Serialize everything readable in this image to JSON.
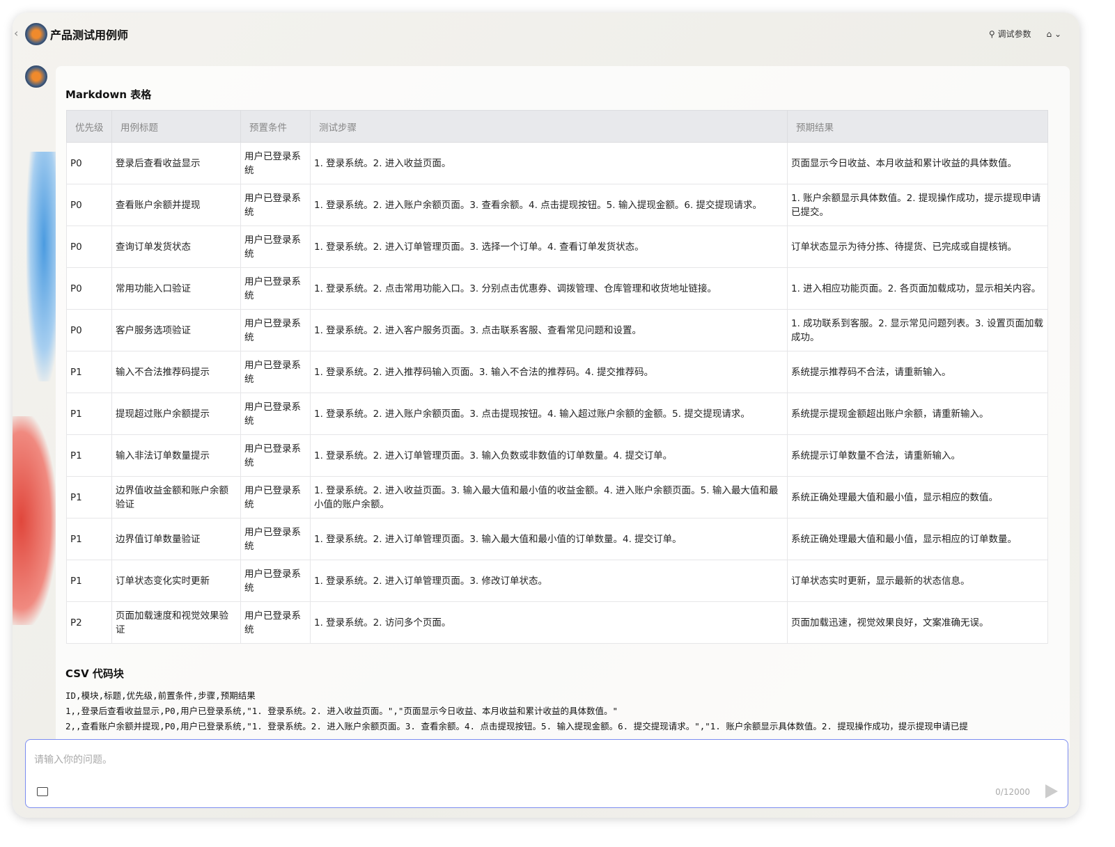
{
  "header": {
    "title": "产品测试用例师",
    "debug_label": "调试参数"
  },
  "md_title": "Markdown 表格",
  "table": {
    "headers": [
      "优先级",
      "用例标题",
      "预置条件",
      "测试步骤",
      "预期结果"
    ],
    "rows": [
      [
        "P0",
        "登录后查看收益显示",
        "用户已登录系统",
        "1. 登录系统。2. 进入收益页面。",
        "页面显示今日收益、本月收益和累计收益的具体数值。"
      ],
      [
        "P0",
        "查看账户余额并提现",
        "用户已登录系统",
        "1. 登录系统。2. 进入账户余额页面。3. 查看余额。4. 点击提现按钮。5. 输入提现金额。6. 提交提现请求。",
        "1. 账户余额显示具体数值。2. 提现操作成功，提示提现申请已提交。"
      ],
      [
        "P0",
        "查询订单发货状态",
        "用户已登录系统",
        "1. 登录系统。2. 进入订单管理页面。3. 选择一个订单。4. 查看订单发货状态。",
        "订单状态显示为待分拣、待提货、已完成或自提核销。"
      ],
      [
        "P0",
        "常用功能入口验证",
        "用户已登录系统",
        "1. 登录系统。2. 点击常用功能入口。3. 分别点击优惠券、调拨管理、仓库管理和收货地址链接。",
        "1. 进入相应功能页面。2. 各页面加载成功，显示相关内容。"
      ],
      [
        "P0",
        "客户服务选项验证",
        "用户已登录系统",
        "1. 登录系统。2. 进入客户服务页面。3. 点击联系客服、查看常见问题和设置。",
        "1. 成功联系到客服。2. 显示常见问题列表。3. 设置页面加载成功。"
      ],
      [
        "P1",
        "输入不合法推荐码提示",
        "用户已登录系统",
        "1. 登录系统。2. 进入推荐码输入页面。3. 输入不合法的推荐码。4. 提交推荐码。",
        "系统提示推荐码不合法，请重新输入。"
      ],
      [
        "P1",
        "提现超过账户余额提示",
        "用户已登录系统",
        "1. 登录系统。2. 进入账户余额页面。3. 点击提现按钮。4. 输入超过账户余额的金额。5. 提交提现请求。",
        "系统提示提现金额超出账户余额，请重新输入。"
      ],
      [
        "P1",
        "输入非法订单数量提示",
        "用户已登录系统",
        "1. 登录系统。2. 进入订单管理页面。3. 输入负数或非数值的订单数量。4. 提交订单。",
        "系统提示订单数量不合法，请重新输入。"
      ],
      [
        "P1",
        "边界值收益金额和账户余额验证",
        "用户已登录系统",
        "1. 登录系统。2. 进入收益页面。3. 输入最大值和最小值的收益金额。4. 进入账户余额页面。5. 输入最大值和最小值的账户余额。",
        "系统正确处理最大值和最小值，显示相应的数值。"
      ],
      [
        "P1",
        "边界值订单数量验证",
        "用户已登录系统",
        "1. 登录系统。2. 进入订单管理页面。3. 输入最大值和最小值的订单数量。4. 提交订单。",
        "系统正确处理最大值和最小值，显示相应的订单数量。"
      ],
      [
        "P1",
        "订单状态变化实时更新",
        "用户已登录系统",
        "1. 登录系统。2. 进入订单管理页面。3. 修改订单状态。",
        "订单状态实时更新，显示最新的状态信息。"
      ],
      [
        "P2",
        "页面加载速度和视觉效果验证",
        "用户已登录系统",
        "1. 登录系统。2. 访问多个页面。",
        "页面加载迅速，视觉效果良好，文案准确无误。"
      ]
    ]
  },
  "csv_title": "CSV 代码块",
  "csv_lines": [
    "ID,模块,标题,优先级,前置条件,步骤,预期结果",
    "1,,登录后查看收益显示,P0,用户已登录系统,\"1. 登录系统。2. 进入收益页面。\",\"页面显示今日收益、本月收益和累计收益的具体数值。\"",
    "2,,查看账户余额并提现,P0,用户已登录系统,\"1. 登录系统。2. 进入账户余额页面。3. 查看余额。4. 点击提现按钮。5. 输入提现金额。6. 提交提现请求。\",\"1. 账户余额显示具体数值。2. 提现操作成功，提示提现申请已提"
  ],
  "input": {
    "placeholder": "请输入你的问题。",
    "counter": "0/12000"
  }
}
